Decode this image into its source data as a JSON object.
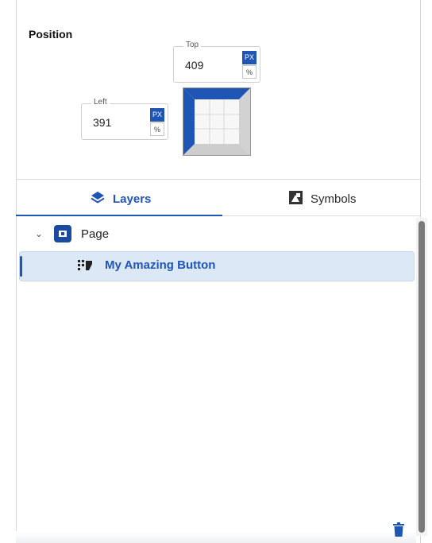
{
  "section": {
    "title": "Position"
  },
  "top_field": {
    "label": "Top",
    "value": "409",
    "unit_selected": "PX",
    "unit_other": "%"
  },
  "left_field": {
    "label": "Left",
    "value": "391",
    "unit_selected": "PX",
    "unit_other": "%"
  },
  "tabs": [
    {
      "label": "Layers",
      "icon": "layers-icon",
      "active": true
    },
    {
      "label": "Symbols",
      "icon": "symbols-icon",
      "active": false
    }
  ],
  "tree": {
    "page": {
      "label": "Page",
      "icon": "page-icon",
      "expanded": true
    },
    "selected_item": {
      "label": "My Amazing Button",
      "icon": "component-icon"
    }
  },
  "colors": {
    "accent": "#1f56b5",
    "selection": "#dde8f6",
    "page_icon": "#1b4b9f"
  }
}
